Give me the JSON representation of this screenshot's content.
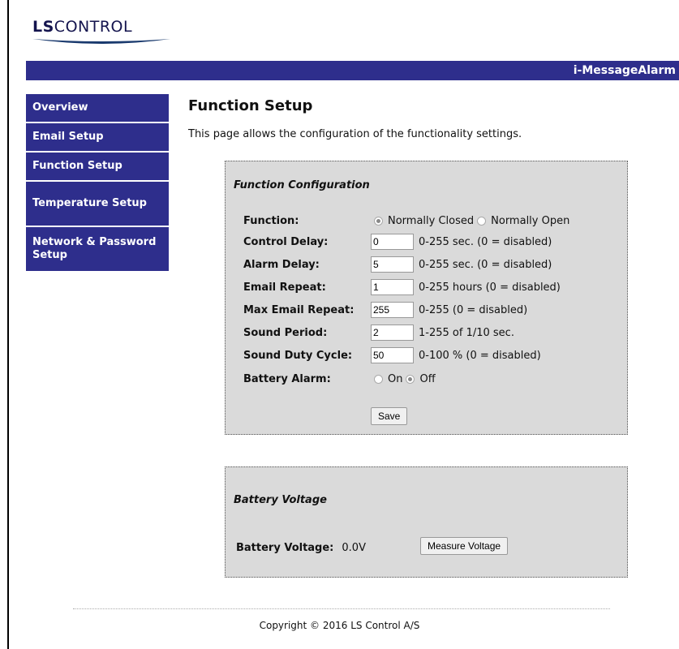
{
  "brand": {
    "logo_bold": "LS",
    "logo_rest": "CONTROL"
  },
  "banner": {
    "product": "i-MessageAlarm"
  },
  "nav": [
    "Overview",
    "Email Setup",
    "Function Setup",
    "Temperature Setup",
    "Network & Password Setup"
  ],
  "page": {
    "title": "Function Setup",
    "intro": "This page allows the configuration of the functionality settings."
  },
  "function_config": {
    "title": "Function Configuration",
    "function": {
      "label": "Function:",
      "options": [
        "Normally Closed",
        "Normally Open"
      ],
      "selected": "Normally Closed"
    },
    "fields": [
      {
        "label": "Control Delay:",
        "value": "0",
        "hint": "0-255 sec. (0 = disabled)"
      },
      {
        "label": "Alarm Delay:",
        "value": "5",
        "hint": "0-255 sec. (0 = disabled)"
      },
      {
        "label": "Email Repeat:",
        "value": "1",
        "hint": "0-255 hours (0 = disabled)"
      },
      {
        "label": "Max Email Repeat:",
        "value": "255",
        "hint": "0-255 (0 = disabled)"
      },
      {
        "label": "Sound Period:",
        "value": "2",
        "hint": "1-255 of 1/10 sec."
      },
      {
        "label": "Sound Duty Cycle:",
        "value": "50",
        "hint": "0-100 % (0 = disabled)"
      }
    ],
    "battery_alarm": {
      "label": "Battery Alarm:",
      "options": [
        "On",
        "Off"
      ],
      "selected": "Off"
    },
    "save_label": "Save"
  },
  "battery": {
    "title": "Battery Voltage",
    "label": "Battery Voltage:",
    "value": "0.0V",
    "measure_label": "Measure Voltage"
  },
  "footer": {
    "copyright": "Copyright © 2016 LS Control A/S"
  }
}
